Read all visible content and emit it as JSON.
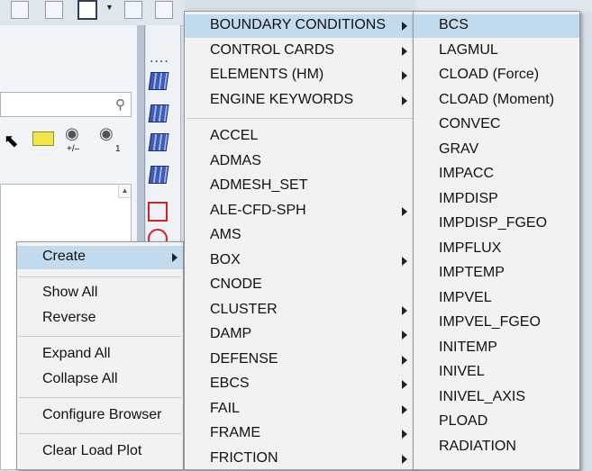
{
  "toolbar": {
    "items": [
      "add-icon",
      "component-icon",
      "file-icon",
      "dropdown-caret",
      "icon-a",
      "icon-b"
    ]
  },
  "browser": {
    "icon_labels": [
      "+/–",
      "1"
    ]
  },
  "context_menu": {
    "groups": [
      [
        {
          "label": "Create",
          "submenu": true,
          "highlighted": true
        }
      ],
      [
        {
          "label": "Show All"
        },
        {
          "label": "Reverse"
        }
      ],
      [
        {
          "label": "Expand All"
        },
        {
          "label": "Collapse All"
        }
      ],
      [
        {
          "label": "Configure Browser"
        }
      ],
      [
        {
          "label": "Clear Load Plot"
        }
      ]
    ]
  },
  "create_submenu": {
    "top_items": [
      {
        "label": "BOUNDARY CONDITIONS",
        "submenu": true,
        "highlighted": true
      },
      {
        "label": "CONTROL CARDS",
        "submenu": true
      },
      {
        "label": "ELEMENTS (HM)",
        "submenu": true
      },
      {
        "label": "ENGINE KEYWORDS",
        "submenu": true
      }
    ],
    "items": [
      {
        "label": "ACCEL"
      },
      {
        "label": "ADMAS"
      },
      {
        "label": "ADMESH_SET"
      },
      {
        "label": "ALE-CFD-SPH",
        "submenu": true
      },
      {
        "label": "AMS"
      },
      {
        "label": "BOX",
        "submenu": true
      },
      {
        "label": "CNODE"
      },
      {
        "label": "CLUSTER",
        "submenu": true
      },
      {
        "label": "DAMP",
        "submenu": true
      },
      {
        "label": "DEFENSE",
        "submenu": true
      },
      {
        "label": "EBCS",
        "submenu": true
      },
      {
        "label": "FAIL",
        "submenu": true
      },
      {
        "label": "FRAME",
        "submenu": true
      },
      {
        "label": "FRICTION",
        "submenu": true
      }
    ]
  },
  "bc_submenu": {
    "items": [
      {
        "label": "BCS",
        "highlighted": true
      },
      {
        "label": "LAGMUL"
      },
      {
        "label": "CLOAD (Force)"
      },
      {
        "label": "CLOAD (Moment)"
      },
      {
        "label": "CONVEC"
      },
      {
        "label": "GRAV"
      },
      {
        "label": "IMPACC"
      },
      {
        "label": "IMPDISP"
      },
      {
        "label": "IMPDISP_FGEO"
      },
      {
        "label": "IMPFLUX"
      },
      {
        "label": "IMPTEMP"
      },
      {
        "label": "IMPVEL"
      },
      {
        "label": "IMPVEL_FGEO"
      },
      {
        "label": "INITEMP"
      },
      {
        "label": "INIVEL"
      },
      {
        "label": "INIVEL_AXIS"
      },
      {
        "label": "PLOAD"
      },
      {
        "label": "RADIATION"
      }
    ]
  },
  "colors": {
    "menu_bg": "#f2f2f2",
    "highlight": "#c2dbef",
    "panel_bg": "#d7dfe9"
  }
}
